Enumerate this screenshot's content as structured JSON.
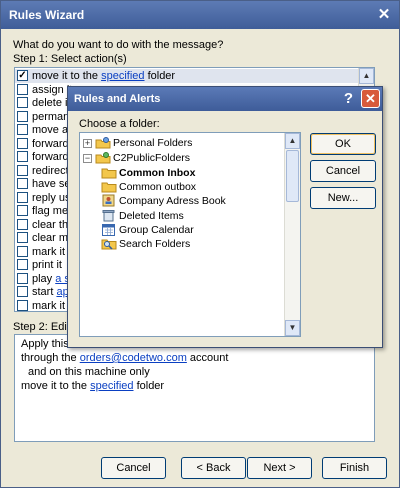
{
  "rules_wizard": {
    "title": "Rules Wizard",
    "question": "What do you want to do with the message?",
    "step1_label": "Step 1: Select action(s)",
    "step2_label": "Step 2: Edit",
    "actions": [
      {
        "label_before": "move it to the ",
        "link": "specified",
        "label_after": " folder",
        "checked": true,
        "selected": true
      },
      {
        "label_before": "assign it",
        "link": "",
        "label_after": "",
        "checked": false,
        "selected": false
      },
      {
        "label_before": "delete it",
        "link": "",
        "label_after": "",
        "checked": false,
        "selected": false
      },
      {
        "label_before": "permane",
        "link": "",
        "label_after": "",
        "checked": false,
        "selected": false
      },
      {
        "label_before": "move a",
        "link": "",
        "label_after": "",
        "checked": false,
        "selected": false
      },
      {
        "label_before": "forward",
        "link": "",
        "label_after": "",
        "checked": false,
        "selected": false
      },
      {
        "label_before": "forward",
        "link": "",
        "label_after": "",
        "checked": false,
        "selected": false
      },
      {
        "label_before": "redirect",
        "link": "",
        "label_after": "",
        "checked": false,
        "selected": false
      },
      {
        "label_before": "have se",
        "link": "",
        "label_after": "",
        "checked": false,
        "selected": false
      },
      {
        "label_before": "reply us",
        "link": "",
        "label_after": "",
        "checked": false,
        "selected": false
      },
      {
        "label_before": "flag mes",
        "link": "",
        "label_after": "",
        "checked": false,
        "selected": false
      },
      {
        "label_before": "clear the",
        "link": "",
        "label_after": "",
        "checked": false,
        "selected": false
      },
      {
        "label_before": "clear me",
        "link": "",
        "label_after": "",
        "checked": false,
        "selected": false
      },
      {
        "label_before": "mark it a",
        "link": "",
        "label_after": "",
        "checked": false,
        "selected": false
      },
      {
        "label_before": "print it",
        "link": "",
        "label_after": "",
        "checked": false,
        "selected": false
      },
      {
        "label_before": "play ",
        "link": "a so",
        "label_after": "",
        "checked": false,
        "selected": false
      },
      {
        "label_before": "start ",
        "link": "ap",
        "label_after": "",
        "checked": false,
        "selected": false
      },
      {
        "label_before": "mark it a",
        "link": "",
        "label_after": "",
        "checked": false,
        "selected": false
      }
    ],
    "description": {
      "line1": "Apply this",
      "line2_before": "through the ",
      "line2_link": "orders@codetwo.com",
      "line2_after": " account",
      "line3": "and on this machine only",
      "line4_before": "move it to the ",
      "line4_link": "specified",
      "line4_after": " folder"
    },
    "buttons": {
      "cancel": "Cancel",
      "back": "< Back",
      "next": "Next >",
      "finish": "Finish"
    },
    "close_glyph": "✕"
  },
  "rules_alerts": {
    "title": "Rules and Alerts",
    "help_glyph": "?",
    "close_glyph": "✕",
    "choose_label": "Choose a folder:",
    "buttons": {
      "ok": "OK",
      "cancel": "Cancel",
      "new": "New..."
    },
    "folders": [
      {
        "label": "Personal Folders",
        "icon": "personal-folders-icon",
        "expander": "+"
      },
      {
        "label": "C2PublicFolders",
        "icon": "public-folders-icon",
        "expander": "−"
      },
      {
        "label": "Common Inbox",
        "icon": "folder-icon",
        "bold": true
      },
      {
        "label": "Common outbox",
        "icon": "folder-icon"
      },
      {
        "label": "Company Adress Book",
        "icon": "address-book-icon"
      },
      {
        "label": "Deleted Items",
        "icon": "deleted-items-icon"
      },
      {
        "label": "Group Calendar",
        "icon": "calendar-icon"
      },
      {
        "label": "Search Folders",
        "icon": "search-folder-icon"
      }
    ]
  },
  "colors": {
    "link": "#0a3fc2",
    "title_bar": "#4a68a6",
    "dialog_bg": "#ece9d8",
    "selection": "#dfe4ee",
    "close_button": "#d85a3a"
  }
}
